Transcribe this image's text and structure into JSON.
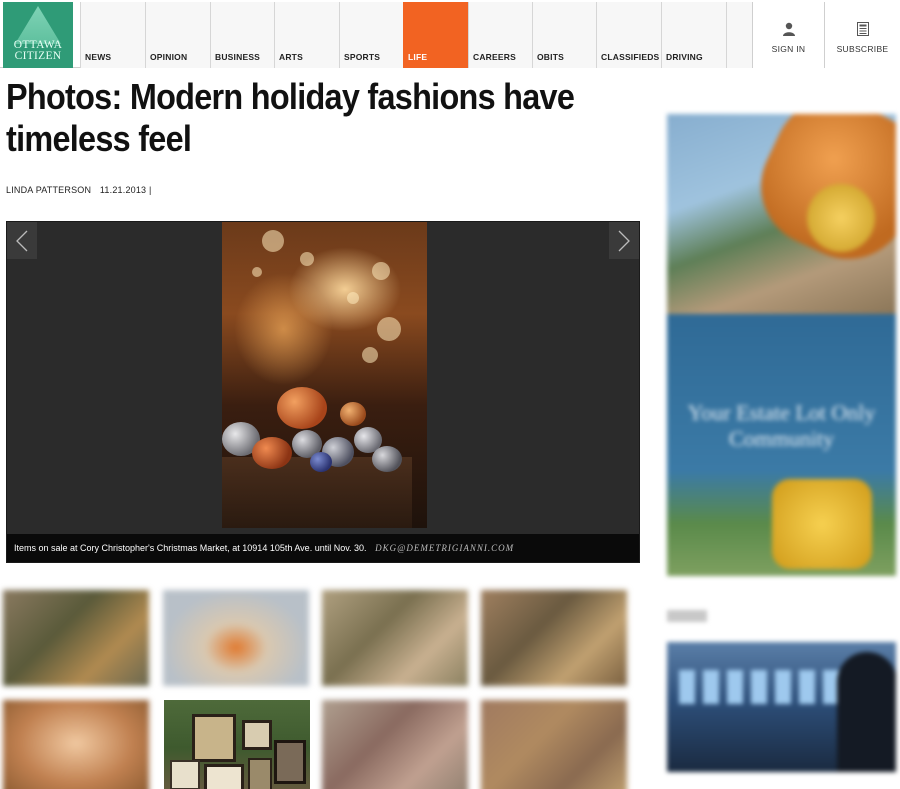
{
  "site": {
    "logo_line1": "OTTAWA",
    "logo_line2": "CITIZEN",
    "brand_green": "#2f9b77",
    "accent": "#f26322"
  },
  "nav": {
    "items": [
      {
        "label": "NEWS"
      },
      {
        "label": "OPINION"
      },
      {
        "label": "BUSINESS"
      },
      {
        "label": "ARTS"
      },
      {
        "label": "SPORTS"
      },
      {
        "label": "LIFE",
        "active": true
      },
      {
        "label": "CAREERS"
      },
      {
        "label": "OBITS"
      },
      {
        "label": "CLASSIFIEDS"
      },
      {
        "label": "DRIVING"
      }
    ],
    "sign_in": "SIGN IN",
    "subscribe": "SUBSCRIBE",
    "sign_in_icon": "user-icon",
    "subscribe_icon": "newspaper-icon"
  },
  "article": {
    "headline": "Photos: Modern holiday fashions have timeless feel",
    "author": "LINDA PATTERSON",
    "date": "11.21.2013 |"
  },
  "gallery": {
    "prev_icon": "chevron-left-icon",
    "next_icon": "chevron-right-icon",
    "caption": "Items on sale at Cory Christopher's Christmas Market, at 10914 105th Ave. until Nov. 30.",
    "credit": "DKG@DEMETRIGIANNI.COM"
  },
  "ad": {
    "headline": "Your Estate Lot Only Community"
  }
}
